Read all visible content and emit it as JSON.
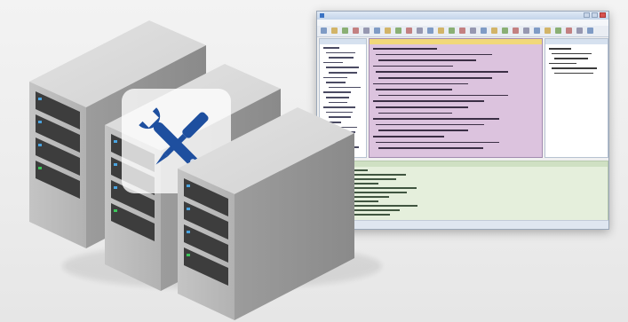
{
  "colors": {
    "tool_badge_blue": "#1e4f9f",
    "editor_pane": "#dcc3de",
    "output_pane": "#e5efdc",
    "server_body": "#b9b9b9"
  },
  "illustration": {
    "servers": [
      "server-tower-back",
      "server-tower-middle",
      "server-tower-front"
    ],
    "badge_icon": "wrench-screwdriver-icon"
  },
  "window": {
    "title": "",
    "menu_items": [],
    "panes": [
      "tree-pane",
      "editor-pane",
      "properties-pane",
      "output-pane"
    ]
  }
}
